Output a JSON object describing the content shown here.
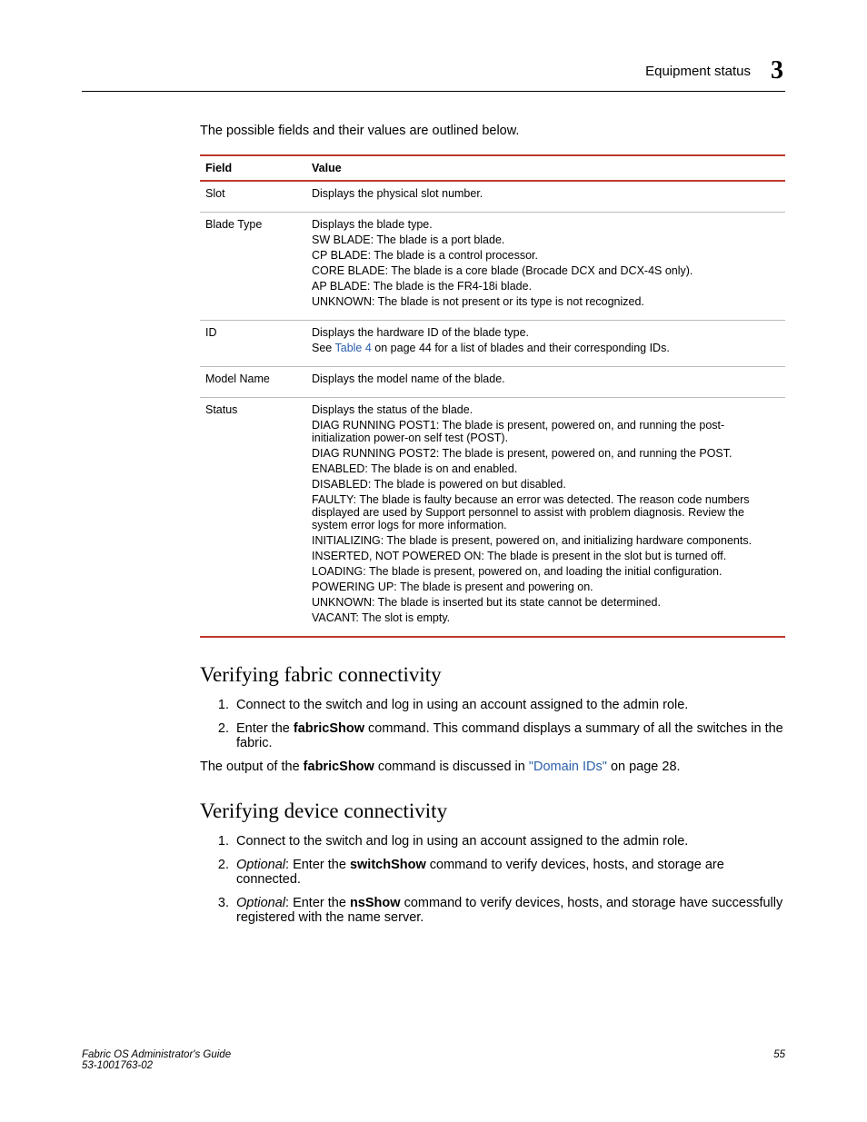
{
  "header": {
    "section": "Equipment status",
    "chapter": "3"
  },
  "intro": "The possible fields and their values are outlined below.",
  "table": {
    "headers": {
      "field": "Field",
      "value": "Value"
    },
    "rows": [
      {
        "field": "Slot",
        "lines": [
          "Displays the physical slot number."
        ]
      },
      {
        "field": "Blade Type",
        "lines": [
          "Displays the blade type.",
          "SW BLADE: The blade is a port blade.",
          "CP BLADE: The blade is a control processor.",
          "CORE BLADE: The blade is a core blade (Brocade DCX and DCX-4S only).",
          "AP BLADE: The blade is the FR4-18i blade.",
          "UNKNOWN: The blade is not present or its type is not recognized."
        ]
      },
      {
        "field": "ID",
        "lines": [
          "Displays the hardware ID of the blade type."
        ],
        "extra": {
          "prefix": "See ",
          "link": "Table 4",
          "suffix": " on page 44 for a list of blades and their corresponding IDs."
        }
      },
      {
        "field": "Model Name",
        "lines": [
          "Displays the model name of the blade."
        ]
      },
      {
        "field": "Status",
        "lines": [
          "Displays the status of the blade.",
          "DIAG RUNNING POST1: The blade is present, powered on, and running the post-initialization power-on self test (POST).",
          "DIAG RUNNING POST2: The blade is present, powered on, and running the POST.",
          "ENABLED: The blade is on and enabled.",
          "DISABLED: The blade is powered on but disabled.",
          "FAULTY: The blade is faulty because an error was detected. The reason code numbers displayed are used by Support personnel to assist with problem diagnosis. Review the system error logs for more information.",
          "INITIALIZING: The blade is present, powered on, and initializing hardware components.",
          "INSERTED, NOT POWERED ON: The blade is present in the slot but is turned off.",
          "LOADING: The blade is present, powered on, and loading the initial configuration.",
          "POWERING UP: The blade is present and powering on.",
          "UNKNOWN: The blade is inserted but its state cannot be determined.",
          "VACANT: The slot is empty."
        ]
      }
    ]
  },
  "sections": {
    "fabric": {
      "heading": "Verifying fabric connectivity",
      "step1": "Connect to the switch and log in using an account assigned to the admin role.",
      "step2_pre": "Enter the ",
      "step2_cmd": "fabricShow",
      "step2_post": " command. This command displays a summary of all the switches in the fabric.",
      "para_pre": "The output of the ",
      "para_cmd": "fabricShow",
      "para_mid": " command is discussed in ",
      "para_link": "\"Domain IDs\"",
      "para_post": " on page 28."
    },
    "device": {
      "heading": "Verifying device connectivity",
      "step1": "Connect to the switch and log in using an account assigned to the admin role.",
      "step2_opt": "Optional",
      "step2_pre": ": Enter the ",
      "step2_cmd": "switchShow",
      "step2_post": " command to verify devices, hosts, and storage are connected.",
      "step3_opt": "Optional",
      "step3_pre": ": Enter the ",
      "step3_cmd": "nsShow",
      "step3_post": " command to verify devices, hosts, and storage have successfully registered with the name server."
    }
  },
  "footer": {
    "title": "Fabric OS Administrator's Guide",
    "docno": "53-1001763-02",
    "page": "55"
  }
}
